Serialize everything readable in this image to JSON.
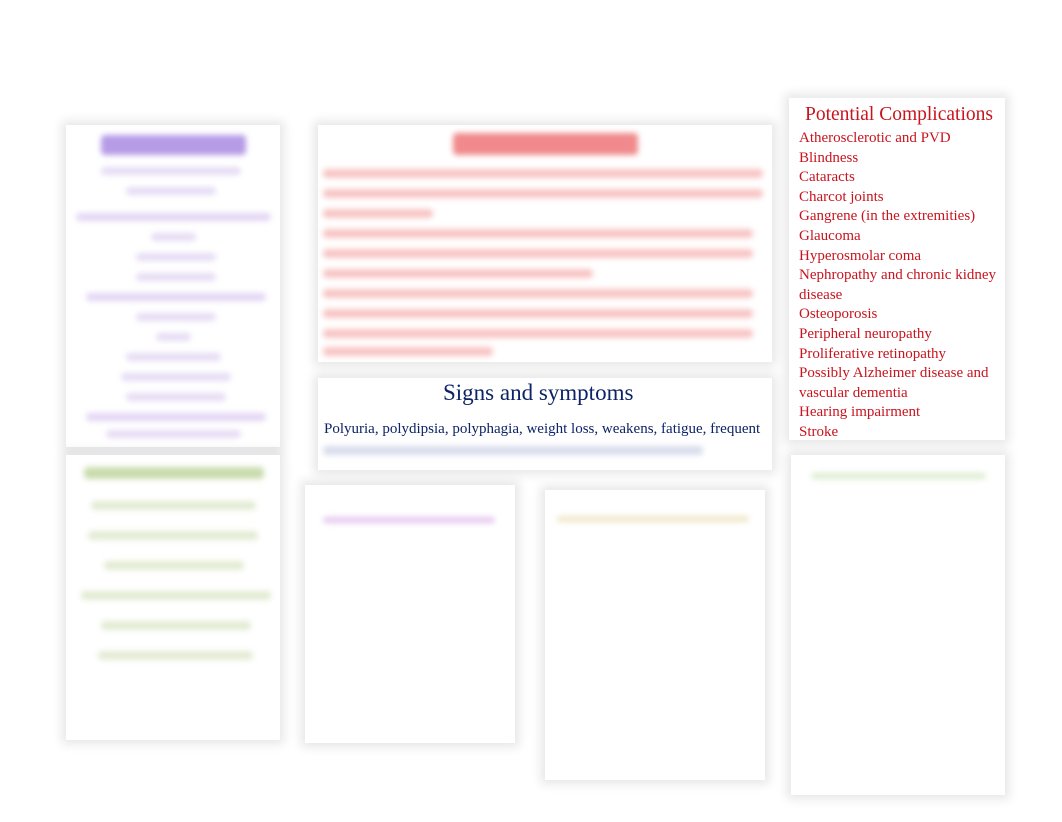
{
  "complications": {
    "title": "Potential Complications",
    "items": [
      "Atherosclerotic and PVD",
      "Blindness",
      "Cataracts",
      "Charcot joints",
      "Gangrene (in the extremities)",
      "Glaucoma",
      "Hyperosmolar coma",
      "Nephropathy and chronic kidney disease",
      "Osteoporosis",
      "Peripheral neuropathy",
      "Proliferative retinopathy",
      "Possibly Alzheimer disease and vascular dementia",
      "Hearing impairment",
      "Stroke"
    ]
  },
  "signs": {
    "title": "Signs and symptoms",
    "text": "Polyuria, polydipsia, polyphagia, weight loss, weakens, fatigue, frequent"
  },
  "colors": {
    "complications": "#c8141e",
    "signs": "#0d2366",
    "risk": "#9b6fd6",
    "patho": "#e8343a",
    "diagnostics": "#8fb85a"
  }
}
